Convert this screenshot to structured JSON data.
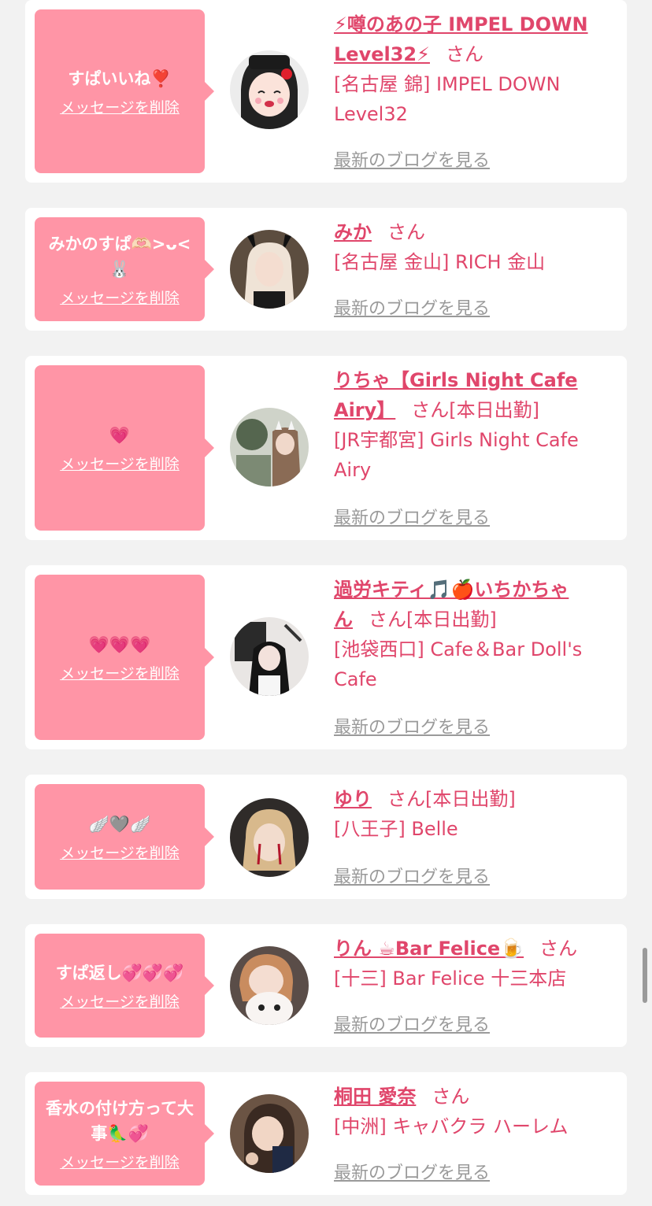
{
  "delete_label": "メッセージを削除",
  "blog_label": "最新のブログを見る",
  "san_label": "さん",
  "messages": [
    {
      "bubble_text": "すぱいいね❣️",
      "name_line1": "⚡噂のあの子 IMPEL DOWN",
      "name_line2": "Level32⚡",
      "status": "",
      "shop": "[名古屋 錦] IMPEL DOWN Level32",
      "avatar_colors": [
        "#2b2b2b",
        "#f3d6cf"
      ]
    },
    {
      "bubble_text": "みかのすぱ🫶🏻>ᴗ<🐰",
      "name_line1": "みか",
      "name_line2": "",
      "status": "",
      "shop": "[名古屋 金山] RICH 金山",
      "avatar_colors": [
        "#3a2f28",
        "#e8d3c4"
      ]
    },
    {
      "bubble_text": "💗",
      "name_line1": "りちゃ【Girls Night Cafe",
      "name_line2": "Airy】",
      "status": "[本日出勤]",
      "shop": "[JR宇都宮] Girls Night Cafe Airy",
      "avatar_colors": [
        "#5b6a5a",
        "#cfd6c8"
      ]
    },
    {
      "bubble_text": "💗💗💗",
      "name_line1": "過労キティ🎵🍎いちかちゃ",
      "name_line2": "ん",
      "status": "[本日出勤]",
      "shop": "[池袋西口] Cafe＆Bar Doll's Cafe",
      "avatar_colors": [
        "#1e1e1e",
        "#d9d0cc"
      ]
    },
    {
      "bubble_text": "🪽🩶🪽",
      "name_line1": "ゆり",
      "name_line2": "",
      "status": "[本日出勤]",
      "shop": "[八王子] Belle",
      "avatar_colors": [
        "#2a2624",
        "#e3c9a8"
      ]
    },
    {
      "bubble_text": "すぱ返し💞💞💞",
      "name_line1": "りん ☕Bar Felice🍺",
      "name_line2": "",
      "status": "",
      "shop": "[十三] Bar Felice 十三本店",
      "avatar_colors": [
        "#3b3330",
        "#f0e6e2"
      ]
    },
    {
      "bubble_text": "香水の付け方って大事🦜💞",
      "name_line1": "桐田 愛奈",
      "name_line2": "",
      "status": "",
      "shop": "[中洲] キャバクラ ハーレム",
      "avatar_colors": [
        "#4a3a30",
        "#e6c9b5"
      ]
    }
  ]
}
